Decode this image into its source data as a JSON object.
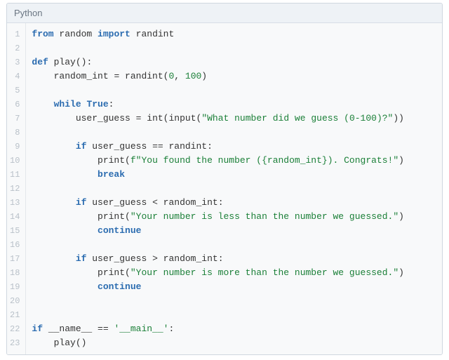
{
  "header": {
    "language": "Python"
  },
  "code": {
    "lines": [
      {
        "n": 1,
        "tokens": [
          {
            "t": "from",
            "c": "kw"
          },
          {
            "t": " random ",
            "c": "nm"
          },
          {
            "t": "import",
            "c": "kw"
          },
          {
            "t": " randint",
            "c": "nm"
          }
        ]
      },
      {
        "n": 2,
        "tokens": []
      },
      {
        "n": 3,
        "tokens": [
          {
            "t": "def",
            "c": "kw"
          },
          {
            "t": " ",
            "c": ""
          },
          {
            "t": "play",
            "c": "fn"
          },
          {
            "t": "():",
            "c": "op"
          }
        ]
      },
      {
        "n": 4,
        "tokens": [
          {
            "t": "    random_int ",
            "c": "nm"
          },
          {
            "t": "=",
            "c": "op"
          },
          {
            "t": " randint(",
            "c": "nm"
          },
          {
            "t": "0",
            "c": "num"
          },
          {
            "t": ", ",
            "c": "op"
          },
          {
            "t": "100",
            "c": "num"
          },
          {
            "t": ")",
            "c": "op"
          }
        ]
      },
      {
        "n": 5,
        "tokens": []
      },
      {
        "n": 6,
        "tokens": [
          {
            "t": "    ",
            "c": ""
          },
          {
            "t": "while",
            "c": "kw"
          },
          {
            "t": " ",
            "c": ""
          },
          {
            "t": "True",
            "c": "kw"
          },
          {
            "t": ":",
            "c": "op"
          }
        ]
      },
      {
        "n": 7,
        "tokens": [
          {
            "t": "        user_guess ",
            "c": "nm"
          },
          {
            "t": "=",
            "c": "op"
          },
          {
            "t": " ",
            "c": ""
          },
          {
            "t": "int",
            "c": "bi"
          },
          {
            "t": "(",
            "c": "op"
          },
          {
            "t": "input",
            "c": "bi"
          },
          {
            "t": "(",
            "c": "op"
          },
          {
            "t": "\"What number did we guess (0-100)?\"",
            "c": "str"
          },
          {
            "t": "))",
            "c": "op"
          }
        ]
      },
      {
        "n": 8,
        "tokens": []
      },
      {
        "n": 9,
        "tokens": [
          {
            "t": "        ",
            "c": ""
          },
          {
            "t": "if",
            "c": "kw"
          },
          {
            "t": " user_guess ",
            "c": "nm"
          },
          {
            "t": "==",
            "c": "op"
          },
          {
            "t": " randint:",
            "c": "nm"
          }
        ]
      },
      {
        "n": 10,
        "tokens": [
          {
            "t": "            ",
            "c": ""
          },
          {
            "t": "print",
            "c": "bi"
          },
          {
            "t": "(",
            "c": "op"
          },
          {
            "t": "f\"You found the number ({random_int}). Congrats!\"",
            "c": "str"
          },
          {
            "t": ")",
            "c": "op"
          }
        ]
      },
      {
        "n": 11,
        "tokens": [
          {
            "t": "            ",
            "c": ""
          },
          {
            "t": "break",
            "c": "kw"
          }
        ]
      },
      {
        "n": 12,
        "tokens": []
      },
      {
        "n": 13,
        "tokens": [
          {
            "t": "        ",
            "c": ""
          },
          {
            "t": "if",
            "c": "kw"
          },
          {
            "t": " user_guess ",
            "c": "nm"
          },
          {
            "t": "<",
            "c": "op"
          },
          {
            "t": " random_int:",
            "c": "nm"
          }
        ]
      },
      {
        "n": 14,
        "tokens": [
          {
            "t": "            ",
            "c": ""
          },
          {
            "t": "print",
            "c": "bi"
          },
          {
            "t": "(",
            "c": "op"
          },
          {
            "t": "\"Your number is less than the number we guessed.\"",
            "c": "str"
          },
          {
            "t": ")",
            "c": "op"
          }
        ]
      },
      {
        "n": 15,
        "tokens": [
          {
            "t": "            ",
            "c": ""
          },
          {
            "t": "continue",
            "c": "kw"
          }
        ]
      },
      {
        "n": 16,
        "tokens": []
      },
      {
        "n": 17,
        "tokens": [
          {
            "t": "        ",
            "c": ""
          },
          {
            "t": "if",
            "c": "kw"
          },
          {
            "t": " user_guess ",
            "c": "nm"
          },
          {
            "t": ">",
            "c": "op"
          },
          {
            "t": " random_int:",
            "c": "nm"
          }
        ]
      },
      {
        "n": 18,
        "tokens": [
          {
            "t": "            ",
            "c": ""
          },
          {
            "t": "print",
            "c": "bi"
          },
          {
            "t": "(",
            "c": "op"
          },
          {
            "t": "\"Your number is more than the number we guessed.\"",
            "c": "str"
          },
          {
            "t": ")",
            "c": "op"
          }
        ]
      },
      {
        "n": 19,
        "tokens": [
          {
            "t": "            ",
            "c": ""
          },
          {
            "t": "continue",
            "c": "kw"
          }
        ]
      },
      {
        "n": 20,
        "tokens": []
      },
      {
        "n": 21,
        "tokens": []
      },
      {
        "n": 22,
        "tokens": [
          {
            "t": "if",
            "c": "kw"
          },
          {
            "t": " __name__ ",
            "c": "nm"
          },
          {
            "t": "==",
            "c": "op"
          },
          {
            "t": " ",
            "c": ""
          },
          {
            "t": "'__main__'",
            "c": "str"
          },
          {
            "t": ":",
            "c": "op"
          }
        ]
      },
      {
        "n": 23,
        "tokens": [
          {
            "t": "    play()",
            "c": "nm"
          }
        ]
      }
    ]
  }
}
